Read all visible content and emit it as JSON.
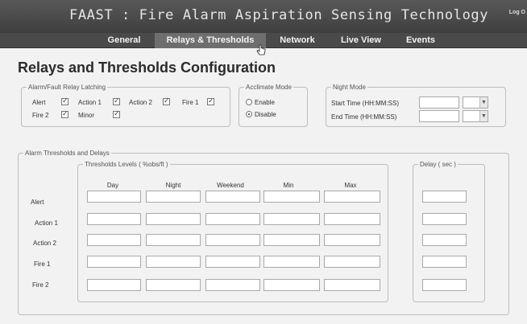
{
  "header": {
    "title": "FAAST : Fire Alarm Aspiration Sensing Technology",
    "logout": "Log O"
  },
  "tabs": [
    {
      "label": "General"
    },
    {
      "label": "Relays & Thresholds",
      "active": true
    },
    {
      "label": "Network"
    },
    {
      "label": "Live View"
    },
    {
      "label": "Events"
    }
  ],
  "page": {
    "title": "Relays and Thresholds Configuration"
  },
  "relay_latching": {
    "legend": "Alarm/Fault Relay Latching",
    "items": [
      {
        "label": "Alert",
        "checked": true
      },
      {
        "label": "Action 1",
        "checked": true
      },
      {
        "label": "Action 2",
        "checked": true
      },
      {
        "label": "Fire 1",
        "checked": true
      },
      {
        "label": "Fire 2",
        "checked": true
      },
      {
        "label": "Minor",
        "checked": true
      }
    ]
  },
  "acclimate": {
    "legend": "Acclimate Mode",
    "options": [
      {
        "label": "Enable",
        "selected": false
      },
      {
        "label": "Disable",
        "selected": true
      }
    ]
  },
  "night_mode": {
    "legend": "Night Mode",
    "start_label": "Start Time (HH:MM:SS)",
    "end_label": "End Time (HH:MM:SS)",
    "start_value": "",
    "end_value": ""
  },
  "thresholds": {
    "legend": "Alarm Thresholds and Delays",
    "levels_legend": "Thresholds Levels ( %obs/ft )",
    "delay_legend": "Delay ( sec )",
    "columns": [
      "Day",
      "Night",
      "Weekend",
      "Min",
      "Max"
    ],
    "rows": [
      "Alert",
      "Action 1",
      "Action 2",
      "Fire 1",
      "Fire 2"
    ]
  }
}
